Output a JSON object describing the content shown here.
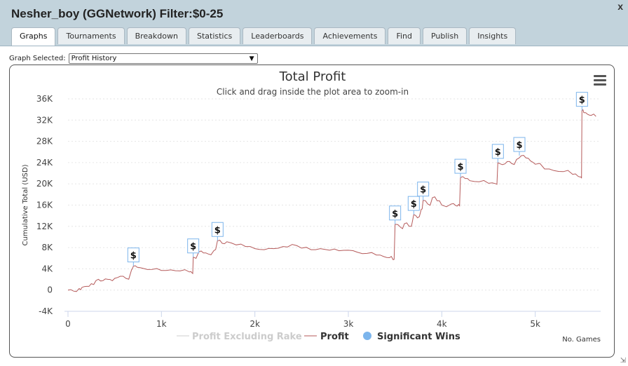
{
  "window": {
    "title": "Nesher_boy (GGNetwork) Filter:$0-25",
    "close_label": "x"
  },
  "tabs": [
    {
      "label": "Graphs",
      "active": true
    },
    {
      "label": "Tournaments"
    },
    {
      "label": "Breakdown"
    },
    {
      "label": "Statistics"
    },
    {
      "label": "Leaderboards"
    },
    {
      "label": "Achievements"
    },
    {
      "label": "Find"
    },
    {
      "label": "Publish"
    },
    {
      "label": "Insights"
    }
  ],
  "graph_selector": {
    "label": "Graph Selected:",
    "value": "Profit History"
  },
  "chart_data": {
    "type": "line",
    "title": "Total Profit",
    "subtitle": "Click and drag inside the plot area to zoom-in",
    "ylabel": "Cumulative Total (USD)",
    "xlabel": "No. Games",
    "xlim": [
      0,
      5700
    ],
    "ylim": [
      -4000,
      36000
    ],
    "xticks": [
      "0",
      "1k",
      "2k",
      "3k",
      "4k",
      "5k"
    ],
    "yticks": [
      "-4K",
      "0",
      "4K",
      "8K",
      "12K",
      "16K",
      "20K",
      "24K",
      "28K",
      "32K",
      "36K"
    ],
    "grid": true,
    "legend_placement": "bottom",
    "colors": {
      "profit": "#b55a5a",
      "excluding_rake": "#cccccc",
      "significant_wins": "#7cb5ec"
    },
    "series": [
      {
        "name": "Profit",
        "x": [
          0,
          60,
          120,
          150,
          200,
          250,
          300,
          350,
          400,
          450,
          500,
          560,
          620,
          680,
          700,
          740,
          800,
          900,
          1000,
          1100,
          1200,
          1300,
          1330,
          1340,
          1400,
          1450,
          1500,
          1560,
          1600,
          1650,
          1700,
          1800,
          1900,
          2000,
          2100,
          2200,
          2300,
          2400,
          2500,
          2600,
          2700,
          2800,
          2900,
          3000,
          3100,
          3200,
          3300,
          3380,
          3440,
          3480,
          3500,
          3560,
          3600,
          3650,
          3700,
          3740,
          3780,
          3800,
          3850,
          3900,
          3950,
          4000,
          4050,
          4100,
          4150,
          4180,
          4200,
          4250,
          4300,
          4400,
          4500,
          4580,
          4600,
          4650,
          4700,
          4750,
          4800,
          4850,
          4900,
          4950,
          5000,
          5100,
          5200,
          5300,
          5400,
          5460,
          5490,
          5500,
          5520,
          5560,
          5600,
          5650
        ],
        "values": [
          0,
          -200,
          300,
          500,
          700,
          1200,
          1800,
          1700,
          2100,
          2000,
          2200,
          2600,
          2200,
          3800,
          4500,
          4300,
          4100,
          3900,
          3700,
          3800,
          3600,
          3400,
          3200,
          6200,
          7200,
          7000,
          6800,
          7400,
          9300,
          8800,
          9100,
          8500,
          8200,
          7800,
          7600,
          7800,
          8200,
          8600,
          7900,
          7600,
          7800,
          7500,
          7400,
          7500,
          7100,
          6900,
          6600,
          6300,
          6100,
          5700,
          12400,
          11800,
          12500,
          12000,
          14200,
          13600,
          15200,
          16900,
          16200,
          17400,
          16800,
          16000,
          15700,
          16200,
          15900,
          16100,
          21200,
          21000,
          20600,
          20400,
          20100,
          20000,
          24000,
          23600,
          24200,
          23800,
          24600,
          25300,
          24900,
          24300,
          23700,
          22800,
          22500,
          22300,
          21800,
          21400,
          21300,
          33800,
          33400,
          33100,
          32900,
          32700
        ]
      },
      {
        "name": "Profit Excluding Rake",
        "visible": false
      },
      {
        "name": "Significant Wins",
        "x": [
          700,
          1340,
          1600,
          3500,
          3700,
          3800,
          4200,
          4600,
          4830,
          5500
        ],
        "values": [
          4500,
          6200,
          9300,
          12400,
          14200,
          16900,
          21200,
          24000,
          25300,
          33800
        ],
        "marker_label": "$"
      }
    ]
  }
}
